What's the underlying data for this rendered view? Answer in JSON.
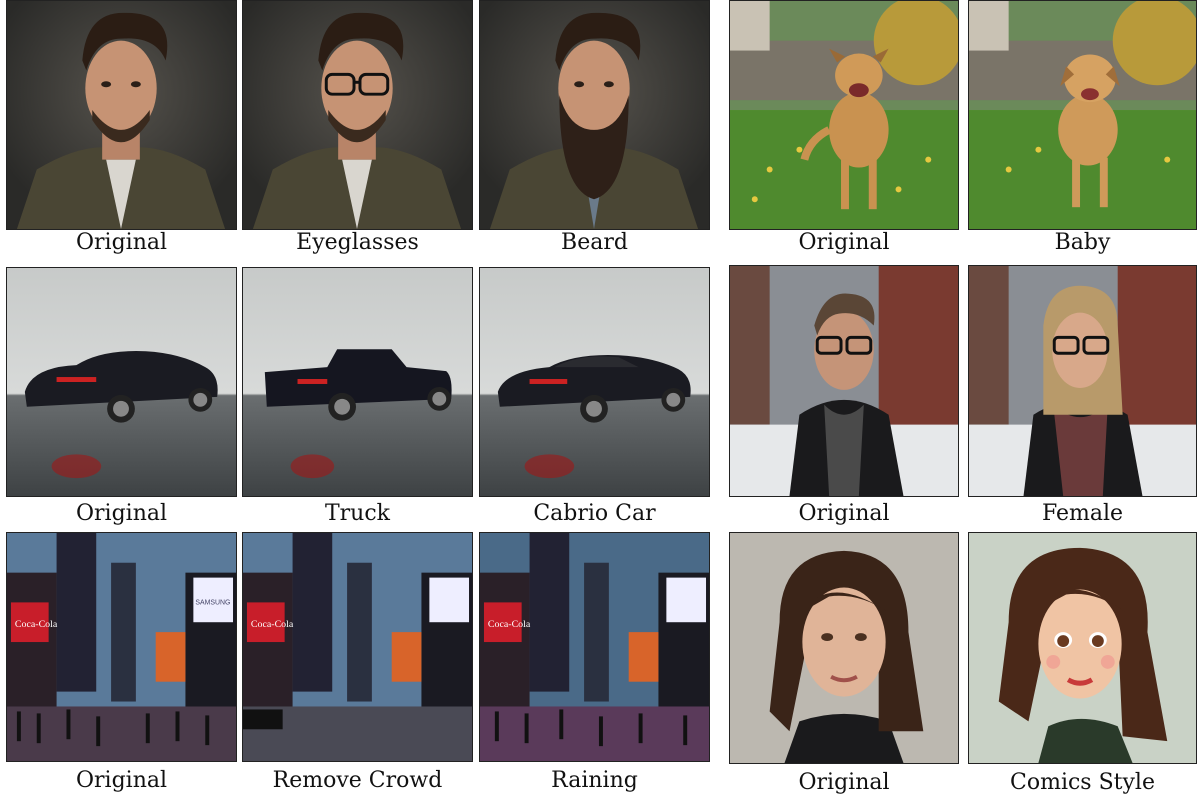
{
  "panels": [
    {
      "id": "man-original",
      "caption": "Original",
      "scene": "man-portrait"
    },
    {
      "id": "man-eyeglasses",
      "caption": "Eyeglasses",
      "scene": "man-portrait-glasses"
    },
    {
      "id": "man-beard",
      "caption": "Beard",
      "scene": "man-portrait-beard"
    },
    {
      "id": "dog-original",
      "caption": "Original",
      "scene": "dog-adult"
    },
    {
      "id": "dog-baby",
      "caption": "Baby",
      "scene": "dog-puppy"
    },
    {
      "id": "car-original",
      "caption": "Original",
      "scene": "sedan"
    },
    {
      "id": "car-truck",
      "caption": "Truck",
      "scene": "pickup"
    },
    {
      "id": "car-cabrio",
      "caption": "Cabrio Car",
      "scene": "convertible"
    },
    {
      "id": "person-original",
      "caption": "Original",
      "scene": "man-snow"
    },
    {
      "id": "person-female",
      "caption": "Female",
      "scene": "woman-snow"
    },
    {
      "id": "city-original",
      "caption": "Original",
      "scene": "times-square-crowd"
    },
    {
      "id": "city-remove-crowd",
      "caption": "Remove Crowd",
      "scene": "times-square-empty"
    },
    {
      "id": "city-raining",
      "caption": "Raining",
      "scene": "times-square-rain"
    },
    {
      "id": "woman-original",
      "caption": "Original",
      "scene": "woman-photo"
    },
    {
      "id": "woman-comics",
      "caption": "Comics Style",
      "scene": "woman-cartoon"
    }
  ],
  "billboard_text": {
    "brand": "Coca-Cola",
    "samsung": "SAMSUNG"
  },
  "colors": {
    "caption": "#111111",
    "border": "#222222"
  }
}
